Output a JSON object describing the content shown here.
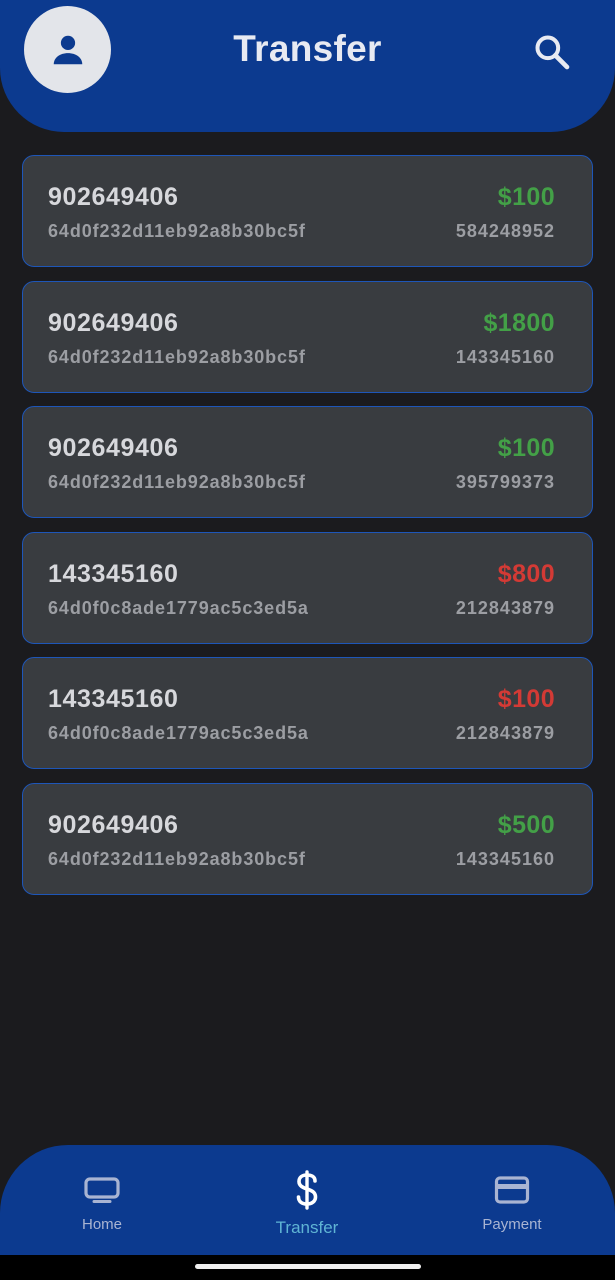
{
  "header": {
    "title": "Transfer",
    "avatar_icon": "person-icon",
    "search_icon": "search-icon",
    "background_color": "#0c3a8f"
  },
  "transfers": [
    {
      "account": "902649406",
      "tx_id": "64d0f232d11eb92a8b30bc5f",
      "amount": "$100",
      "ref": "584248952",
      "direction": "in"
    },
    {
      "account": "902649406",
      "tx_id": "64d0f232d11eb92a8b30bc5f",
      "amount": "$1800",
      "ref": "143345160",
      "direction": "in"
    },
    {
      "account": "902649406",
      "tx_id": "64d0f232d11eb92a8b30bc5f",
      "amount": "$100",
      "ref": "395799373",
      "direction": "in"
    },
    {
      "account": "143345160",
      "tx_id": "64d0f0c8ade1779ac5c3ed5a",
      "amount": "$800",
      "ref": "212843879",
      "direction": "out"
    },
    {
      "account": "143345160",
      "tx_id": "64d0f0c8ade1779ac5c3ed5a",
      "amount": "$100",
      "ref": "212843879",
      "direction": "out"
    },
    {
      "account": "902649406",
      "tx_id": "64d0f232d11eb92a8b30bc5f",
      "amount": "$500",
      "ref": "143345160",
      "direction": "in"
    }
  ],
  "colors": {
    "incoming": "#43a047",
    "outgoing": "#d33a35",
    "card_border": "#1e56b8",
    "active_tab": "#5fb4d4"
  },
  "bottom_nav": {
    "items": [
      {
        "label": "Home",
        "icon": "tv-icon",
        "active": false
      },
      {
        "label": "Transfer",
        "icon": "dollar-icon",
        "active": true
      },
      {
        "label": "Payment",
        "icon": "credit-card-icon",
        "active": false
      }
    ]
  }
}
